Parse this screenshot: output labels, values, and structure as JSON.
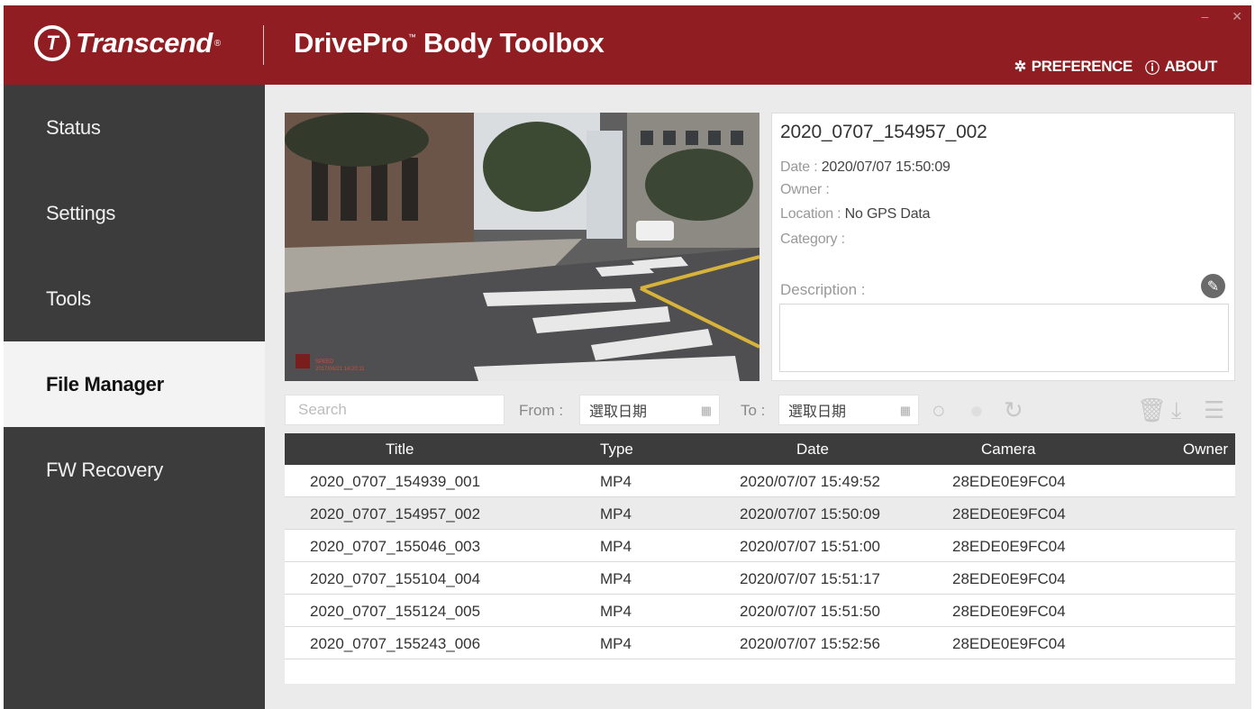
{
  "header": {
    "logo": "Transcend",
    "app_title": "DrivePro",
    "app_title_tm": "™",
    "app_title_rest": "Body Toolbox",
    "preference": "PREFERENCE",
    "about": "ABOUT",
    "preference_icon": "gear-icon",
    "about_icon": "info-icon"
  },
  "sidebar": {
    "items": [
      {
        "label": "Status"
      },
      {
        "label": "Settings"
      },
      {
        "label": "Tools"
      },
      {
        "label": "File Manager",
        "active": true
      },
      {
        "label": "FW Recovery"
      }
    ]
  },
  "preview": {
    "overlay_line1": "SPEED",
    "overlay_line2": "2017/06/21 14:20:11"
  },
  "info": {
    "title": "2020_0707_154957_002",
    "date_label": "Date : ",
    "date_value": "2020/07/07 15:50:09",
    "owner_label": "Owner : ",
    "owner_value": "",
    "location_label": "Location : ",
    "location_value": "No GPS Data",
    "category_label": "Category : ",
    "category_value": "",
    "description_label": "Description :"
  },
  "filter": {
    "search_placeholder": "Search",
    "from_label": "From :",
    "from_value": "選取日期",
    "to_label": "To :",
    "to_value": "選取日期"
  },
  "table": {
    "headers": [
      "Title",
      "Type",
      "Date",
      "Camera",
      "Owner"
    ],
    "rows": [
      {
        "title": "2020_0707_154939_001",
        "type": "MP4",
        "date": "2020/07/07 15:49:52",
        "camera": "28EDE0E9FC04",
        "owner": ""
      },
      {
        "title": "2020_0707_154957_002",
        "type": "MP4",
        "date": "2020/07/07 15:50:09",
        "camera": "28EDE0E9FC04",
        "owner": "",
        "selected": true
      },
      {
        "title": "2020_0707_155046_003",
        "type": "MP4",
        "date": "2020/07/07 15:51:00",
        "camera": "28EDE0E9FC04",
        "owner": ""
      },
      {
        "title": "2020_0707_155104_004",
        "type": "MP4",
        "date": "2020/07/07 15:51:17",
        "camera": "28EDE0E9FC04",
        "owner": ""
      },
      {
        "title": "2020_0707_155124_005",
        "type": "MP4",
        "date": "2020/07/07 15:51:50",
        "camera": "28EDE0E9FC04",
        "owner": ""
      },
      {
        "title": "2020_0707_155243_006",
        "type": "MP4",
        "date": "2020/07/07 15:52:56",
        "camera": "28EDE0E9FC04",
        "owner": ""
      }
    ]
  },
  "colors": {
    "brand_red": "#8f1d22",
    "sidebar_dark": "#3c3c3c",
    "panel_bg": "#ebebeb"
  }
}
